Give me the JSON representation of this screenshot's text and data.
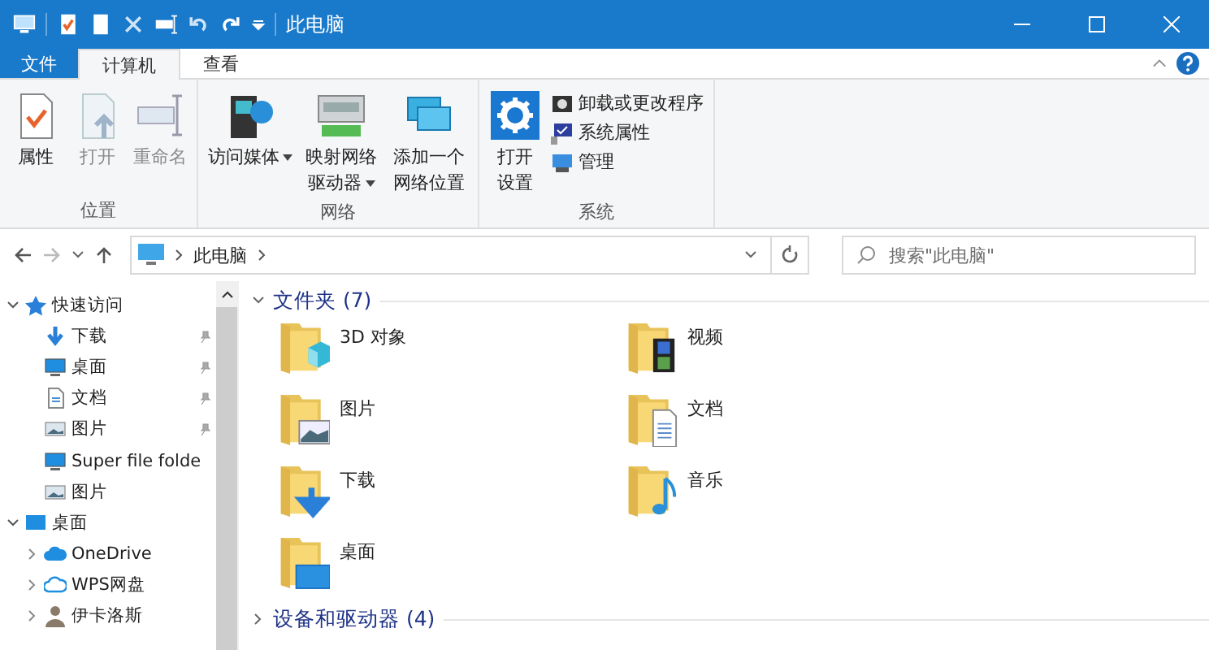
{
  "window": {
    "title": "此电脑"
  },
  "tabs": [
    {
      "label": "文件",
      "kind": "file",
      "selected": false
    },
    {
      "label": "计算机",
      "kind": "tab",
      "selected": true
    },
    {
      "label": "查看",
      "kind": "tab",
      "selected": false
    }
  ],
  "ribbon": {
    "groups": [
      {
        "name": "位置",
        "buttons": [
          {
            "label": "属性",
            "disabled": false,
            "dropdown": false
          },
          {
            "label": "打开",
            "disabled": true,
            "dropdown": false
          },
          {
            "label": "重命名",
            "disabled": true,
            "dropdown": false
          }
        ]
      },
      {
        "name": "网络",
        "buttons": [
          {
            "label": "访问媒体",
            "disabled": false,
            "dropdown": true
          },
          {
            "label": "映射网络驱动器",
            "disabled": false,
            "dropdown": true
          },
          {
            "label": "添加一个网络位置",
            "disabled": false,
            "dropdown": false
          }
        ]
      },
      {
        "name": "系统",
        "buttons": [
          {
            "label": "打开设置",
            "disabled": false,
            "dropdown": false
          }
        ],
        "small_buttons": [
          {
            "label": "卸载或更改程序"
          },
          {
            "label": "系统属性"
          },
          {
            "label": "管理"
          }
        ]
      }
    ]
  },
  "address": {
    "path": "此电脑"
  },
  "search": {
    "placeholder": "搜索\"此电脑\""
  },
  "sidebar": {
    "tree": [
      {
        "label": "快速访问",
        "expanded": true,
        "children": [
          {
            "label": "下载",
            "pinned": true
          },
          {
            "label": "桌面",
            "pinned": true
          },
          {
            "label": "文档",
            "pinned": true
          },
          {
            "label": "图片",
            "pinned": true
          },
          {
            "label": "Super file folde",
            "pinned": false
          },
          {
            "label": "图片",
            "pinned": false
          }
        ]
      },
      {
        "label": "桌面",
        "expanded": true,
        "children": [
          {
            "label": "OneDrive",
            "expanded": false
          },
          {
            "label": "WPS网盘",
            "expanded": false
          },
          {
            "label": "伊卡洛斯",
            "expanded": false
          }
        ]
      }
    ]
  },
  "content": {
    "groups": [
      {
        "title": "文件夹 (7)",
        "expanded": true,
        "items": [
          {
            "name": "3D 对象",
            "kind": "objects"
          },
          {
            "name": "视频",
            "kind": "videos"
          },
          {
            "name": "图片",
            "kind": "pictures"
          },
          {
            "name": "文档",
            "kind": "documents"
          },
          {
            "name": "下载",
            "kind": "downloads"
          },
          {
            "name": "音乐",
            "kind": "music"
          },
          {
            "name": "桌面",
            "kind": "desktop"
          }
        ]
      },
      {
        "title": "设备和驱动器 (4)",
        "expanded": false
      }
    ]
  }
}
